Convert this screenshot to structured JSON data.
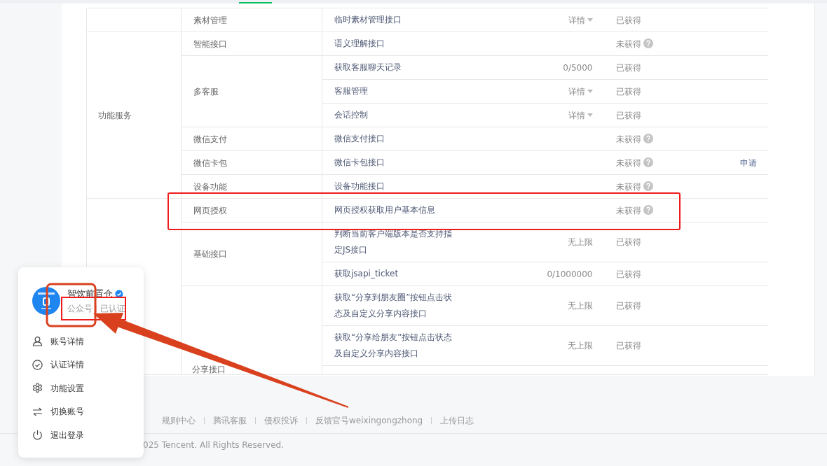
{
  "permission_table": {
    "groups": [
      {
        "subgroups": [
          {
            "name": "素材管理",
            "interfaces": [
              {
                "name": "临时素材管理接口",
                "quota": {
                  "kind": "details",
                  "text": "详情"
                },
                "status": {
                  "text": "已获得",
                  "obtained": true
                }
              }
            ]
          }
        ]
      },
      {
        "category": "功能服务",
        "subgroups": [
          {
            "name": "智能接口",
            "interfaces": [
              {
                "name": "语义理解接口",
                "status": {
                  "text": "未获得",
                  "obtained": false
                }
              }
            ]
          },
          {
            "name": "多客服",
            "interfaces": [
              {
                "name": "获取客服聊天记录",
                "quota": {
                  "kind": "count",
                  "text": "0/5000"
                },
                "status": {
                  "text": "已获得",
                  "obtained": true
                }
              },
              {
                "name": "客服管理",
                "quota": {
                  "kind": "details",
                  "text": "详情"
                },
                "status": {
                  "text": "已获得",
                  "obtained": true
                }
              },
              {
                "name": "会话控制",
                "quota": {
                  "kind": "details",
                  "text": "详情"
                },
                "status": {
                  "text": "已获得",
                  "obtained": true
                }
              }
            ]
          },
          {
            "name": "微信支付",
            "interfaces": [
              {
                "name": "微信支付接口",
                "status": {
                  "text": "未获得",
                  "obtained": false
                }
              }
            ]
          },
          {
            "name": "微信卡包",
            "interfaces": [
              {
                "name": "微信卡包接口",
                "status": {
                  "text": "未获得",
                  "obtained": false
                },
                "action": "申请"
              }
            ]
          },
          {
            "name": "设备功能",
            "interfaces": [
              {
                "name": "设备功能接口",
                "status": {
                  "text": "未获得",
                  "obtained": false
                }
              }
            ]
          }
        ]
      },
      {
        "subgroups": [
          {
            "name": "网页授权",
            "interfaces": [
              {
                "name": "网页授权获取用户基本信息",
                "status": {
                  "text": "未获得",
                  "obtained": false
                }
              }
            ]
          },
          {
            "name": "基础接口",
            "interfaces": [
              {
                "name": "判断当前客户端版本是否支持指定JS接口",
                "quota": {
                  "kind": "count",
                  "text": "无上限"
                },
                "status": {
                  "text": "已获得",
                  "obtained": true
                }
              },
              {
                "name": "获取jsapi_ticket",
                "quota": {
                  "kind": "count",
                  "text": "0/1000000"
                },
                "status": {
                  "text": "已获得",
                  "obtained": true
                }
              }
            ]
          },
          {
            "name": "分享接口",
            "interfaces": [
              {
                "name": "获取“分享到朋友圈”按钮点击状态及自定义分享内容接口",
                "quota": {
                  "kind": "count",
                  "text": "无上限"
                },
                "status": {
                  "text": "已获得",
                  "obtained": true
                }
              },
              {
                "name": "获取“分享给朋友”按钮点击状态及自定义分享内容接口",
                "quota": {
                  "kind": "count",
                  "text": "无上限"
                },
                "status": {
                  "text": "已获得",
                  "obtained": true
                }
              }
            ]
          }
        ]
      }
    ]
  },
  "footer": {
    "links": [
      "规则中心",
      "腾讯客服",
      "侵权投诉",
      "反馈官号weixingongzhong",
      "上传日志"
    ],
    "copyright": "025 Tencent. All Rights Reserved."
  },
  "account_popup": {
    "name": "智饮前置仓",
    "verified": true,
    "account_type": "公众号",
    "certification": "已认证",
    "menu": [
      {
        "label": "账号详情",
        "kind": "account"
      },
      {
        "label": "认证详情",
        "kind": "certification"
      },
      {
        "label": "功能设置",
        "kind": "settings"
      },
      {
        "label": "切换账号",
        "kind": "switch"
      },
      {
        "label": "退出登录",
        "kind": "logout"
      }
    ]
  }
}
